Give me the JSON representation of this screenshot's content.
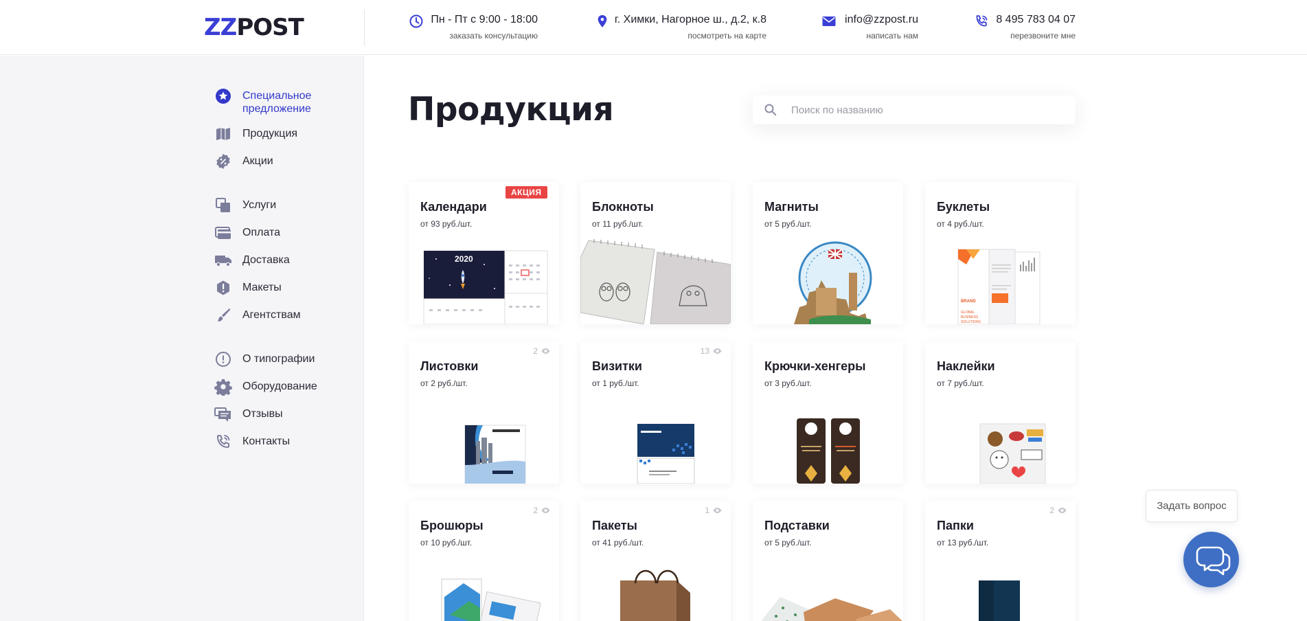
{
  "header": {
    "logo_part1": "ZZ",
    "logo_part2": "POST",
    "contacts": [
      {
        "icon": "clock-icon",
        "main": "Пн - Пт с 9:00 - 18:00",
        "sub": "заказать консультацию"
      },
      {
        "icon": "map-pin-icon",
        "main": "г. Химки, Нагорное ш., д.2, к.8",
        "sub": "посмотреть на карте"
      },
      {
        "icon": "mail-icon",
        "main": "info@zzpost.ru",
        "sub": "написать нам"
      },
      {
        "icon": "phone-icon",
        "main": "8 495 783 04 07",
        "sub": "перезвоните мне"
      }
    ]
  },
  "sidebar": {
    "items": [
      {
        "label": "Специальное предложение",
        "icon": "star-circle-icon",
        "active": true
      },
      {
        "label": "Продукция",
        "icon": "book-icon"
      },
      {
        "label": "Акции",
        "icon": "discount-badge-icon"
      },
      {
        "label": "Услуги",
        "icon": "layers-icon"
      },
      {
        "label": "Оплата",
        "icon": "card-icon"
      },
      {
        "label": "Доставка",
        "icon": "truck-icon"
      },
      {
        "label": "Макеты",
        "icon": "alert-icon"
      },
      {
        "label": "Агентствам",
        "icon": "brush-icon"
      },
      {
        "label": "О типографии",
        "icon": "info-circle-icon"
      },
      {
        "label": "Оборудование",
        "icon": "gear-icon"
      },
      {
        "label": "Отзывы",
        "icon": "chat-icon"
      },
      {
        "label": "Контакты",
        "icon": "phone-icon"
      }
    ]
  },
  "main": {
    "title": "Продукция",
    "search_placeholder": "Поиск по названию",
    "products": [
      {
        "title": "Календари",
        "price": "от 93 руб./шт.",
        "badge": "АКЦИЯ"
      },
      {
        "title": "Блокноты",
        "price": "от 11 руб./шт."
      },
      {
        "title": "Магниты",
        "price": "от 5 руб./шт."
      },
      {
        "title": "Буклеты",
        "price": "от 4 руб./шт."
      },
      {
        "title": "Листовки",
        "price": "от 2 руб./шт.",
        "views": "2"
      },
      {
        "title": "Визитки",
        "price": "от 1 руб./шт.",
        "views": "13"
      },
      {
        "title": "Крючки-хенгеры",
        "price": "от 3 руб./шт."
      },
      {
        "title": "Наклейки",
        "price": "от 7 руб./шт."
      },
      {
        "title": "Брошюры",
        "price": "от 10 руб./шт.",
        "views": "2"
      },
      {
        "title": "Пакеты",
        "price": "от 41 руб./шт.",
        "views": "1"
      },
      {
        "title": "Подставки",
        "price": "от 5 руб./шт."
      },
      {
        "title": "Папки",
        "price": "от 13 руб./шт.",
        "views": "2"
      }
    ]
  },
  "chat": {
    "bubble": "Задать вопрос"
  },
  "colors": {
    "accent": "#3b3fd6",
    "icon": "#7b7d9a",
    "badge": "#e94444",
    "chat": "#3f6fc4"
  }
}
